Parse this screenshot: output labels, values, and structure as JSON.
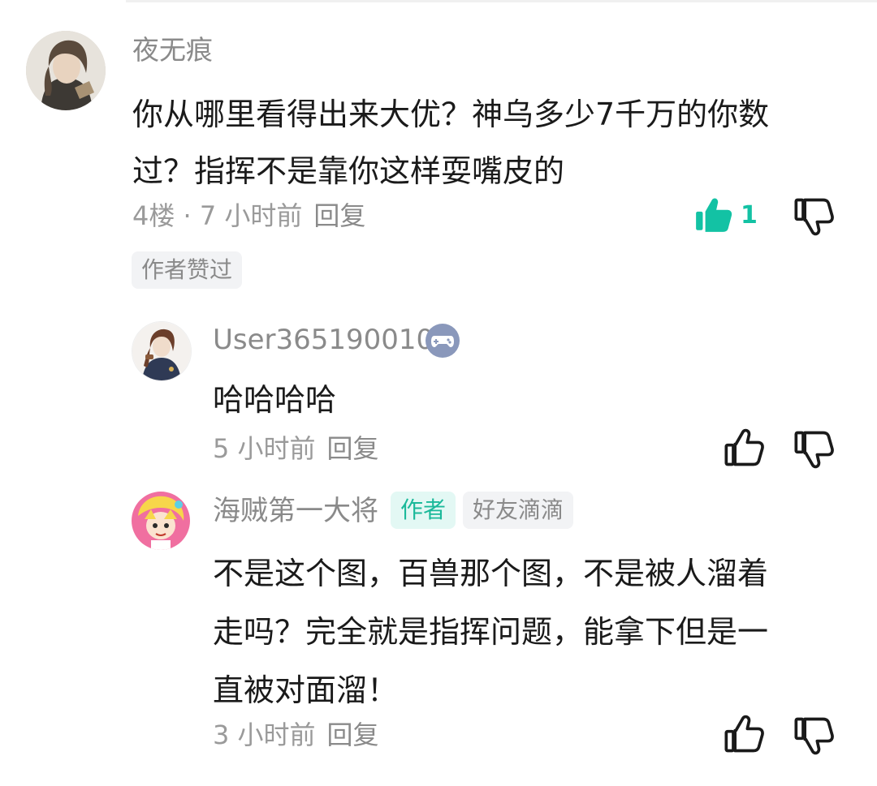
{
  "comments": [
    {
      "username": "夜无痕",
      "content_lines": [
        "你从哪里看得出来大优？神乌多少7千万的你数",
        "过？指挥不是靠你这样耍嘴皮的"
      ],
      "meta": "4楼 · 7 小时前",
      "reply_label": "回复",
      "like_count": "1",
      "author_liked_tag": "作者赞过",
      "liked": true
    }
  ],
  "replies": [
    {
      "username": "User365190010",
      "content_lines": [
        "哈哈哈哈"
      ],
      "meta": "5 小时前",
      "reply_label": "回复",
      "badge_icon": "gamepad-icon"
    },
    {
      "username": "海贼第一大将",
      "author_tag": "作者",
      "friend_tag": "好友滴滴",
      "content_lines": [
        "不是这个图，百兽那个图，不是被人溜着",
        "走吗？完全就是指挥问题，能拿下但是一",
        "直被对面溜！"
      ],
      "meta": "3 小时前",
      "reply_label": "回复"
    }
  ],
  "colors": {
    "accent": "#13c2a4",
    "muted_text": "#8a8a8a",
    "tag_bg": "#f2f3f5",
    "author_tag_bg": "#e3f8f4"
  }
}
